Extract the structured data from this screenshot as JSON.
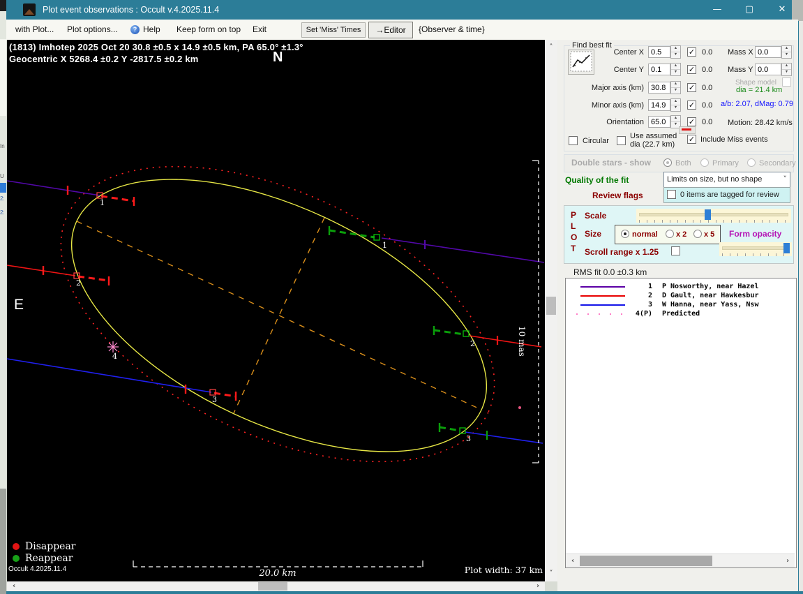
{
  "icons": {
    "check": "✓",
    "spin_up": "▲",
    "spin_down": "▼",
    "left": "‹",
    "right": "›",
    "up": "˄",
    "down": "˅",
    "combo": "˅",
    "help": "?"
  },
  "window": {
    "title": "Plot event observations : Occult v.4.2025.11.4",
    "minimize": "—",
    "maximize": "▢",
    "close": "✕"
  },
  "background_window": {
    "fragments": [
      "In",
      "U",
      "2:",
      "2:"
    ]
  },
  "menu": {
    "with_plot": "with Plot...",
    "plot_options": "Plot options...",
    "help": "Help",
    "keep_on_top": "Keep form on top",
    "exit": "Exit",
    "set_miss_times": "Set 'Miss' Times",
    "editor": "→Editor",
    "observer_time": "{Observer & time}"
  },
  "plot": {
    "title_line1": "(1813) Imhotep  2025 Oct 20   30.8 ±0.5 x 14.9 ±0.5 km,  PA 65.0° ±1.3°",
    "title_line2": "Geocentric  X  5268.4 ±0.2  Y -2817.5 ±0.2 km",
    "north": "N",
    "east": "E",
    "labels": {
      "c1": "1",
      "c2": "2",
      "c3": "3",
      "c4": "4"
    },
    "legend": {
      "disappear": "Disappear",
      "reappear": "Reappear"
    },
    "version": "Occult 4.2025.11.4",
    "scale_bar": "20.0 km",
    "plot_width": "Plot width: 37 km",
    "mas": "10 mas"
  },
  "fit": {
    "group_label": "Find best fit",
    "center_x_label": "Center X",
    "center_x": "0.5",
    "center_x_err": "0.0",
    "center_y_label": "Center Y",
    "center_y": "0.1",
    "center_y_err": "0.0",
    "mass_x_label": "Mass X",
    "mass_x": "0.0",
    "mass_y_label": "Mass Y",
    "mass_y": "0.0",
    "shape_model_label": "Shape model",
    "major_label": "Major axis (km)",
    "major": "30.8",
    "major_err": "0.0",
    "minor_label": "Minor axis (km)",
    "minor": "14.9",
    "minor_err": "0.0",
    "orientation_label": "Orientation",
    "orientation": "65.0",
    "orientation_err": "0.0",
    "dia_label": "dia = 21.4 km",
    "ab_label": "a/b: 2.07, dMag: 0.79",
    "motion_label": "Motion: 28.42 km/s",
    "circular_label": "Circular",
    "assumed_label_1": "Use assumed",
    "assumed_label_2": "dia (22.7 km)",
    "include_miss_label": "Include Miss events"
  },
  "double_stars": {
    "label": "Double stars - show",
    "both": "Both",
    "primary": "Primary",
    "secondary": "Secondary"
  },
  "quality": {
    "label": "Quality of the fit",
    "value": "Limits on size, but no shape"
  },
  "review": {
    "label": "Review flags",
    "value": "0 items are tagged for review"
  },
  "plot_controls": {
    "p": "P",
    "l": "L",
    "o": "O",
    "t": "T",
    "scale": "Scale",
    "size": "Size",
    "opt_normal": "normal",
    "opt_x2": "x 2",
    "opt_x5": "x 5",
    "form_opacity": "Form opacity",
    "scroll_range": "Scroll range x 1.25"
  },
  "rms": "RMS fit 0.0 ±0.3 km",
  "observers": [
    {
      "num": "1",
      "name": "P Nosworthy, near Hazel"
    },
    {
      "num": "2",
      "name": "D Gault, near Hawkesbur"
    },
    {
      "num": "3",
      "name": "W Hanna, near Yass, Nsw"
    },
    {
      "num": "4(P)",
      "name": "Predicted"
    }
  ]
}
